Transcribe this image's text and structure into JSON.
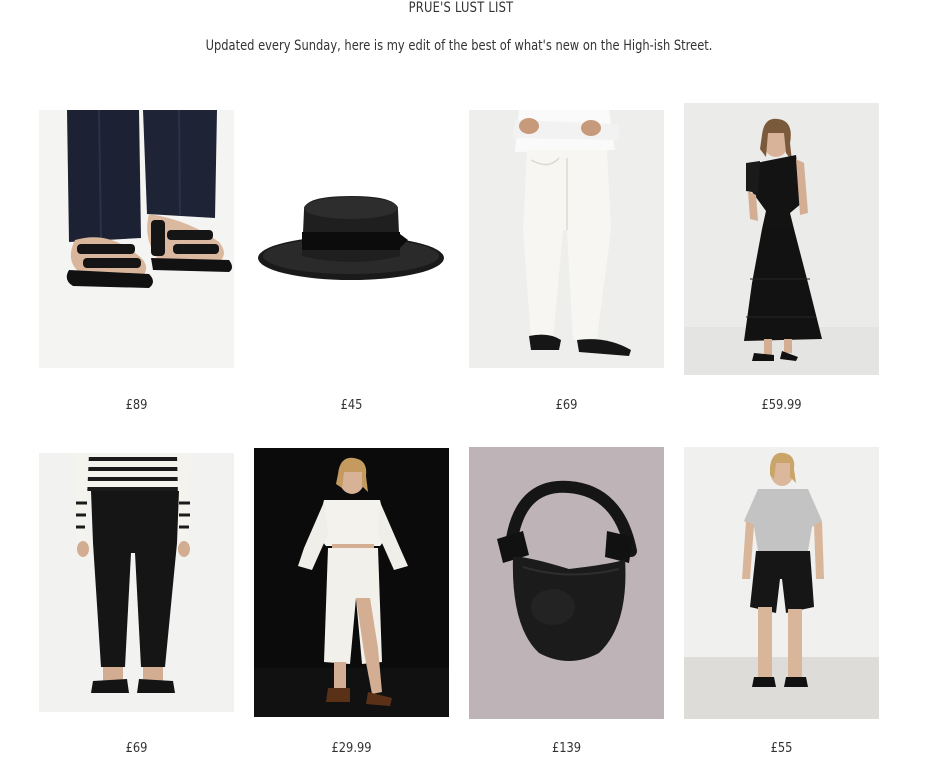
{
  "header": {
    "title": "PRUE'S LUST LIST",
    "subtitle": "Updated every Sunday, here is my edit of the best of what's new on the High-ish Street."
  },
  "products": [
    {
      "price": "£89",
      "icon": "black-sandals-image"
    },
    {
      "price": "£45",
      "icon": "black-straw-boater-hat-image"
    },
    {
      "price": "£69",
      "icon": "white-barrel-jeans-image"
    },
    {
      "price": "£59.99",
      "icon": "black-one-shoulder-dress-image"
    },
    {
      "price": "£69",
      "icon": "black-cropped-trousers-image"
    },
    {
      "price": "£29.99",
      "icon": "white-co-ord-skirt-set-image"
    },
    {
      "price": "£139",
      "icon": "black-knot-handbag-image"
    },
    {
      "price": "£55",
      "icon": "black-denim-shorts-image"
    }
  ]
}
